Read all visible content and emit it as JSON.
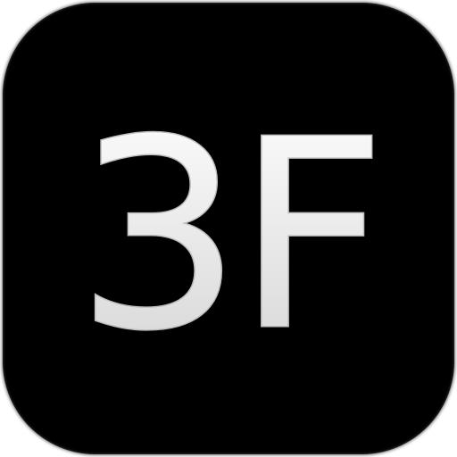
{
  "icon": {
    "text": "3F",
    "background_color": "#000000",
    "text_fill_top": "#ffffff",
    "text_fill_bottom": "#d4d4d4",
    "text_stroke": "#bdbdbd"
  }
}
